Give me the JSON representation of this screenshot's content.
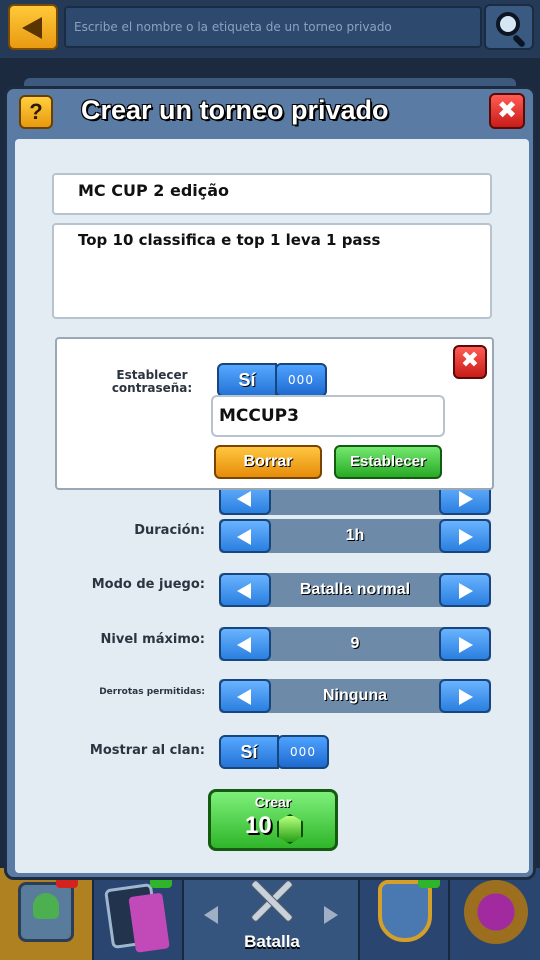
{
  "topbar": {
    "search_placeholder": "Escribe el nombre o la etiqueta de un torneo privado"
  },
  "modal": {
    "help_label": "?",
    "title": "Crear un torneo privado",
    "close_label": "✖",
    "name_value": "MC CUP 2 edição",
    "description_value": "Top 10 classifica e top 1 leva 1 pass"
  },
  "password_popup": {
    "label": "Establecer contraseña:",
    "toggle_label": "Sí",
    "toggle_knob": "000",
    "value": "MCCUP3",
    "close_label": "✖",
    "clear_label": "Borrar",
    "set_label": "Establecer"
  },
  "settings": {
    "duration": {
      "label": "Duración:",
      "value": "1h"
    },
    "game_mode": {
      "label": "Modo de juego:",
      "value": "Batalla normal"
    },
    "max_level": {
      "label": "Nivel máximo:",
      "value": "9"
    },
    "losses": {
      "label": "Derrotas permitidas:",
      "value": "Ninguna"
    },
    "show_clan": {
      "label": "Mostrar al clan:",
      "toggle_label": "Sí",
      "toggle_knob": "000"
    }
  },
  "create_button": {
    "label": "Crear",
    "cost": "10",
    "cost_icon": "gem-icon"
  },
  "bottom_nav": {
    "battle_label": "Batalla"
  },
  "colors": {
    "accent_blue": "#2a7fe0",
    "create_green": "#2fb52a",
    "close_red": "#c81c18",
    "help_yellow": "#e8990f"
  }
}
